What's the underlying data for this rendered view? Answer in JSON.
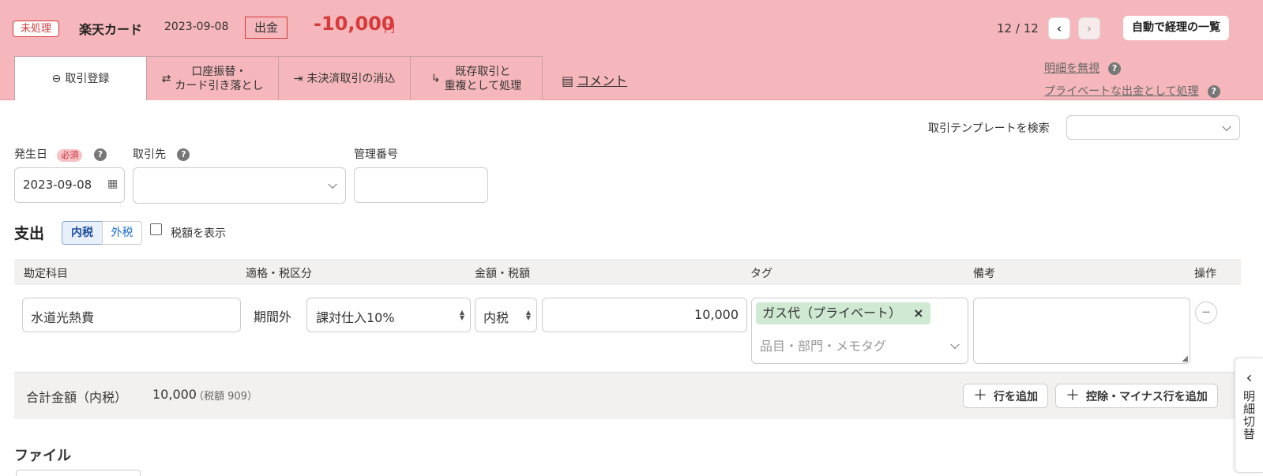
{
  "header": {
    "status_badge": "未処理",
    "card_name": "楽天カード",
    "date": "2023-09-08",
    "direction_badge": "出金",
    "amount": "-10,000",
    "amount_unit": "円",
    "pager": "12 / 12",
    "prev_icon": "‹",
    "next_icon": "›",
    "auto_list_button": "自動で経理の一覧"
  },
  "tabs": [
    {
      "label": "取引登録",
      "icon": "minus-circle-icon"
    },
    {
      "label_line1": "口座振替・",
      "label_line2": "カード引き落とし",
      "icon": "swap-arrows-icon"
    },
    {
      "label": "未決済取引の消込",
      "icon": "merge-icon"
    },
    {
      "label_line1": "既存取引と",
      "label_line2": "重複として処理",
      "icon": "split-arrow-icon"
    }
  ],
  "comment_link": "コメント",
  "side_links": {
    "ignore": "明細を無視",
    "private": "プライベートな出金として処理"
  },
  "template_search": {
    "label": "取引テンプレートを検索",
    "value": ""
  },
  "form": {
    "date_label": "発生日",
    "required_badge": "必須",
    "date_value": "2023-09-08",
    "partner_label": "取引先",
    "partner_value": "",
    "mgmt_label": "管理番号",
    "mgmt_value": ""
  },
  "expense": {
    "heading": "支出",
    "tax_incl": "内税",
    "tax_excl": "外税",
    "show_tax_label": "税額を表示",
    "show_tax_checked": false
  },
  "table": {
    "headers": {
      "account": "勘定科目",
      "tax_class": "適格・税区分",
      "amount_tax": "金額・税額",
      "tag": "タグ",
      "memo": "備考",
      "ops": "操作"
    },
    "row": {
      "account": "水道光熱費",
      "qualified": "期間外",
      "tax_category": "課対仕入10%",
      "tax_mode": "内税",
      "amount": "10,000",
      "tag": "ガス代（プライベート）",
      "tag_remove": "×",
      "tag_placeholder": "品目・部門・メモタグ",
      "memo": "",
      "remove_row": "−"
    }
  },
  "totals": {
    "label": "合計金額（内税）",
    "amount": "10,000",
    "tax_note": "（税額 909）",
    "add_row_button": "行を追加",
    "add_minus_row_button": "控除・マイナス行を追加"
  },
  "file_heading": "ファイル",
  "side_tab": {
    "label": "明細切替",
    "arrow": "‹"
  }
}
